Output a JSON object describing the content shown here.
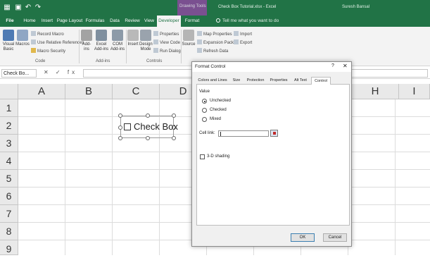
{
  "window": {
    "contextual_tab_group": "Drawing Tools",
    "title": "Check Box Tutorial.xlsx - Excel",
    "user": "Suresh Bansal",
    "qat_icons": [
      "excel-logo-icon",
      "save-icon",
      "undo-icon",
      "redo-icon"
    ]
  },
  "ribbon": {
    "tabs": [
      "File",
      "Home",
      "Insert",
      "Page Layout",
      "Formulas",
      "Data",
      "Review",
      "View",
      "Developer",
      "Format"
    ],
    "active_tab": "Developer",
    "tell_me": "Tell me what you want to do",
    "groups": {
      "code": {
        "label": "Code",
        "visual_basic": "Visual Basic",
        "macros": "Macros",
        "record_macro": "Record Macro",
        "use_relative": "Use Relative References",
        "macro_security": "Macro Security"
      },
      "addins": {
        "label": "Add-ins",
        "add_ins": "Add-ins",
        "excel_add_ins": "Excel Add-ins",
        "com_add_ins": "COM Add-ins"
      },
      "controls": {
        "label": "Controls",
        "insert": "Insert",
        "design_mode": "Design Mode",
        "properties": "Properties",
        "view_code": "View Code",
        "run_dialog": "Run Dialog"
      },
      "xml": {
        "source": "Source",
        "map_properties": "Map Properties",
        "expansion_packs": "Expansion Packs",
        "refresh_data": "Refresh Data",
        "import": "Import",
        "export": "Export"
      }
    }
  },
  "formula_bar": {
    "name_box": "Check Bo...",
    "fx_symbols": "✕ ✓ fx",
    "value": ""
  },
  "sheet": {
    "columns": [
      "A",
      "B",
      "C",
      "D",
      "H",
      "I"
    ],
    "rows": [
      "1",
      "2",
      "3",
      "4",
      "5",
      "6",
      "7",
      "8",
      "9"
    ],
    "checkbox_label": "Check Box"
  },
  "dialog": {
    "title": "Format Control",
    "help": "?",
    "close": "✕",
    "tabs": [
      "Colors and Lines",
      "Size",
      "Protection",
      "Properties",
      "Alt Text",
      "Control"
    ],
    "active_tab": "Control",
    "value_heading": "Value",
    "options": [
      "Unchecked",
      "Checked",
      "Mixed"
    ],
    "selected_option": "Unchecked",
    "cell_link_label": "Cell link:",
    "cell_link_value": "",
    "shading_label": "3-D shading",
    "ok": "OK",
    "cancel": "Cancel"
  },
  "colors": {
    "excel_green": "#217346",
    "drawing_tools": "#8a4b9e"
  }
}
